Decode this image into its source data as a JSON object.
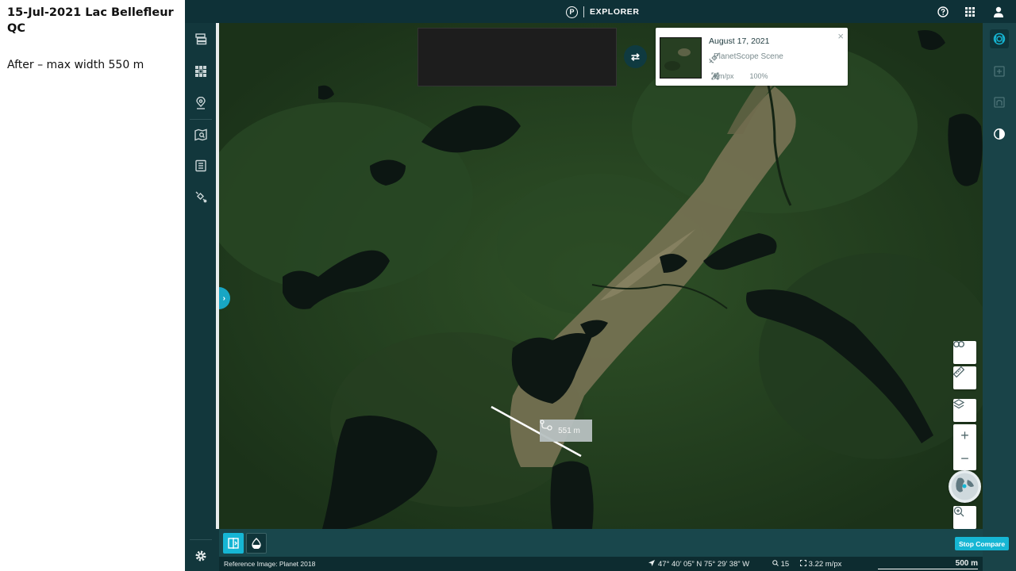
{
  "slide": {
    "title": "15-Jul-2021 Lac Bellefleur QC",
    "subtitle": "After – max width 550 m"
  },
  "app": {
    "logo_letter": "P",
    "name": "EXPLORER"
  },
  "scene_card": {
    "date": "August 17, 2021",
    "type": "PlanetScope Scene",
    "resolution": "3m/px",
    "coverage": "100%",
    "close_symbol": "×"
  },
  "swap_symbol": "⇄",
  "measurement": {
    "label": "551 m"
  },
  "expand_symbol": "›",
  "zoom": {
    "in": "+",
    "out": "−"
  },
  "bottom": {
    "stop_compare": "Stop Compare"
  },
  "status": {
    "reference": "Reference Image: Planet 2018",
    "coordinates": "47° 40’ 05” N 75° 29’ 38” W",
    "zoom_level": "15",
    "resolution": "3.22 m/px",
    "scale": "500 m"
  },
  "colors": {
    "accent": "#16b6d4",
    "panel": "#12373c",
    "header": "#0e3137"
  }
}
